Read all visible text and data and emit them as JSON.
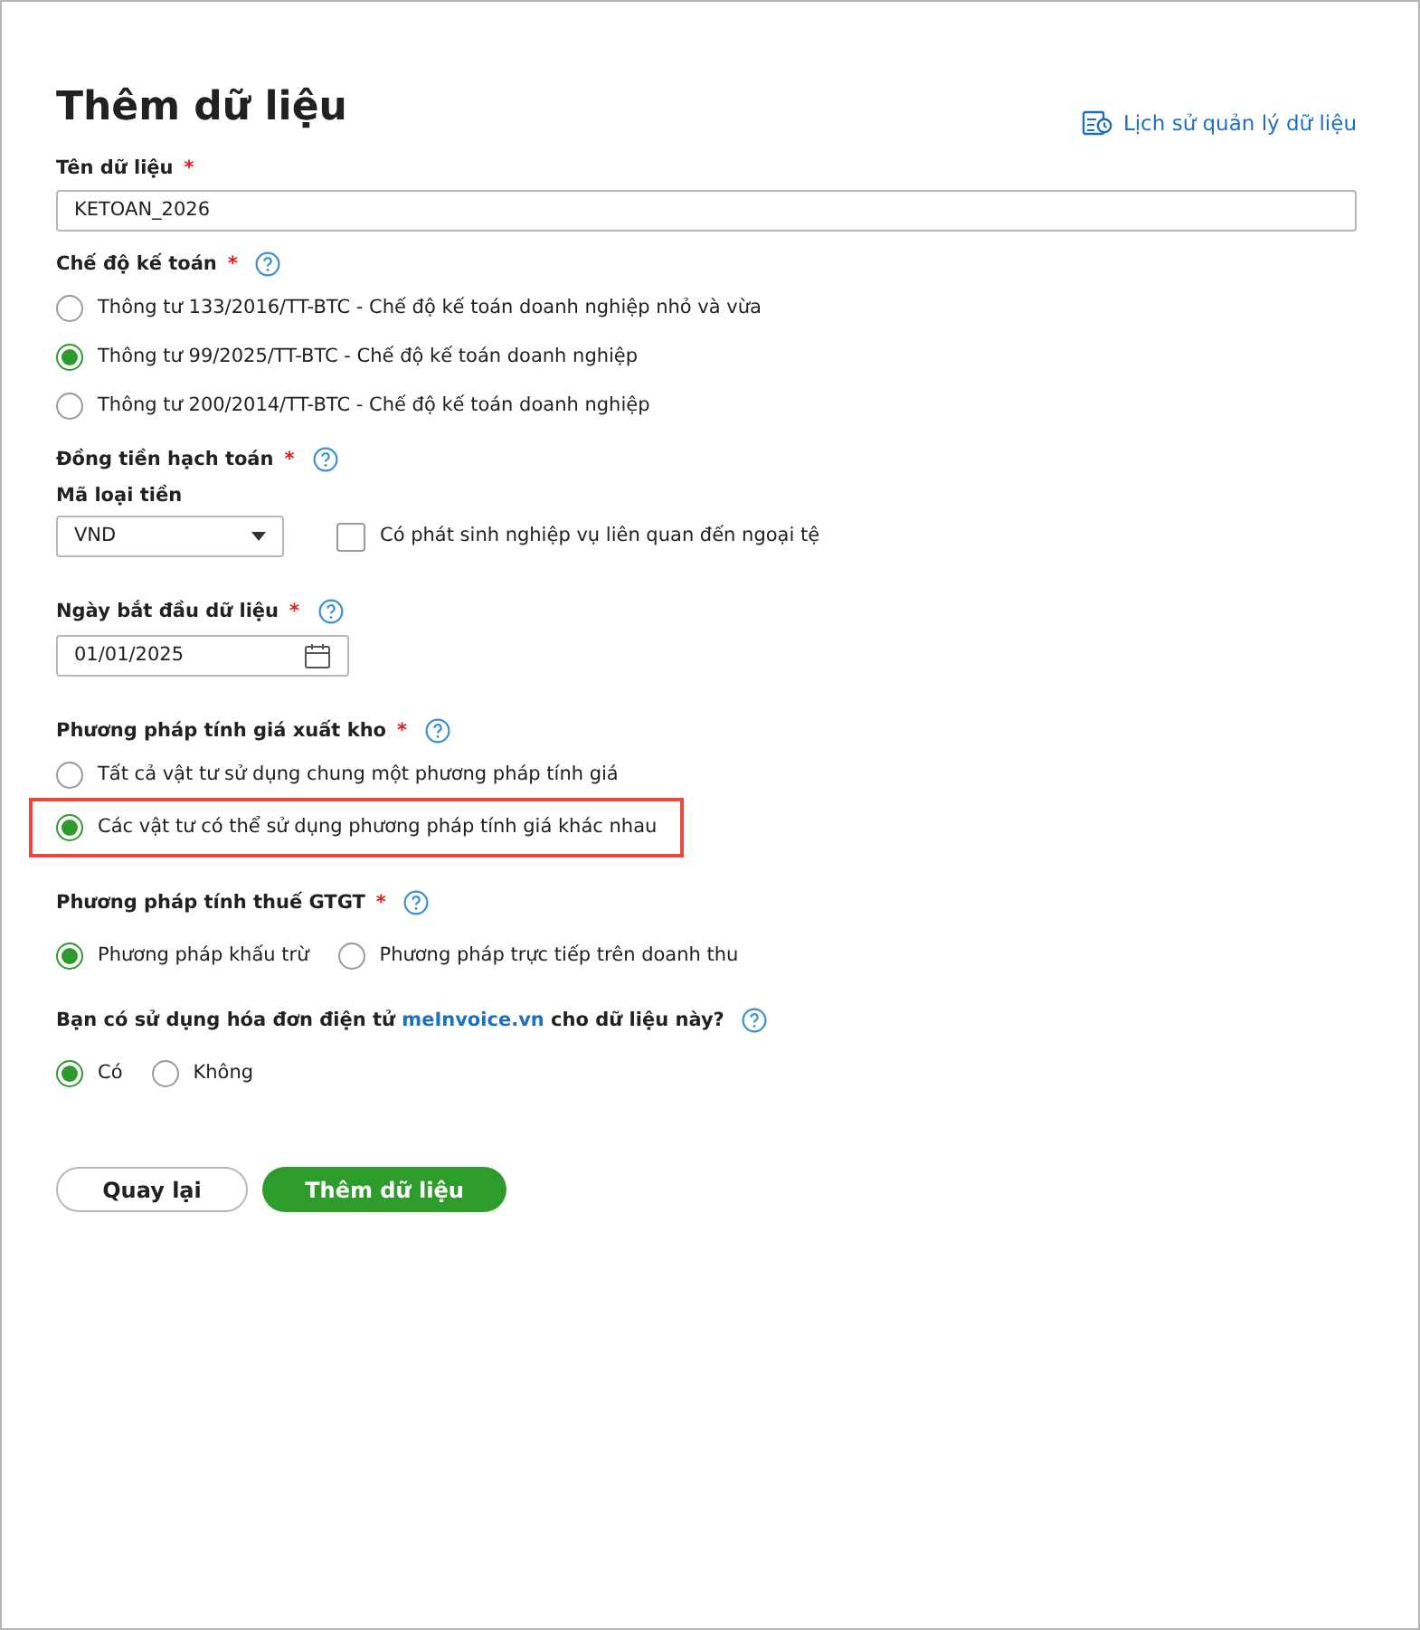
{
  "title": "Thêm dữ liệu",
  "history_link": {
    "label": "Lịch sử quản lý dữ liệu"
  },
  "sections": [
    {
      "kind": "text",
      "label": "Tên dữ liệu",
      "required_mark": "*",
      "value": "KETOAN_2026"
    },
    {
      "kind": "radios",
      "label": "Chế độ kế toán",
      "required_mark": "*",
      "help": true,
      "options": [
        {
          "label": "Thông tư 133/2016/TT-BTC - Chế độ kế toán doanh nghiệp nhỏ và vừa",
          "selected": false,
          "highlighted": false
        },
        {
          "label": "Thông tư 99/2025/TT-BTC - Chế độ kế toán doanh nghiệp",
          "selected": true,
          "highlighted": false
        },
        {
          "label": "Thông tư 200/2014/TT-BTC - Chế độ kế toán doanh nghiệp",
          "selected": false,
          "highlighted": false
        }
      ]
    },
    {
      "kind": "currency",
      "label": "Đồng tiền hạch toán",
      "required_mark": "*",
      "help": true,
      "sublabel": "Mã loại tiền",
      "value": "VND",
      "checkbox": {
        "label": "Có phát sinh nghiệp vụ liên quan đến ngoại tệ",
        "checked": false
      }
    },
    {
      "kind": "date",
      "label": "Ngày bắt đầu dữ liệu",
      "required_mark": "*",
      "help": true,
      "value": "01/01/2025"
    },
    {
      "kind": "radios",
      "label": "Phương pháp tính giá xuất kho",
      "required_mark": "*",
      "help": true,
      "options": [
        {
          "label": "Tất cả vật tư sử dụng chung một phương pháp tính giá",
          "selected": false,
          "highlighted": false
        },
        {
          "label": "Các vật tư có thể sử dụng phương pháp tính giá khác nhau",
          "selected": true,
          "highlighted": true
        }
      ]
    },
    {
      "kind": "radios-inline",
      "label": "Phương pháp tính thuế GTGT",
      "required_mark": "*",
      "help": true,
      "options": [
        {
          "label": "Phương pháp khấu trừ",
          "selected": true,
          "highlighted": false
        },
        {
          "label": "Phương pháp trực tiếp trên doanh thu",
          "selected": false,
          "highlighted": false
        }
      ]
    },
    {
      "kind": "radios-inline",
      "label": "Bạn có sử dụng hóa đơn điện tử",
      "link": "meInvoice.vn",
      "label_end": "cho dữ liệu này?",
      "help": true,
      "options": [
        {
          "label": "Có",
          "selected": true,
          "highlighted": false
        },
        {
          "label": "Không",
          "selected": false,
          "highlighted": false
        }
      ]
    }
  ],
  "buttons": [
    {
      "label": "Quay lại",
      "kind": "secondary"
    },
    {
      "label": "Thêm dữ liệu",
      "kind": "primary"
    }
  ]
}
